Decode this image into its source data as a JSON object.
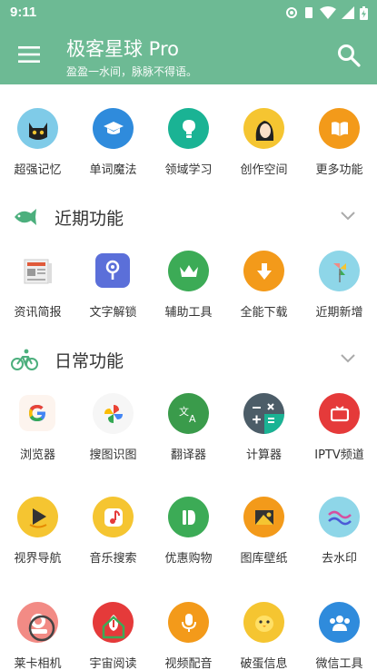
{
  "status": {
    "time": "9:11"
  },
  "app": {
    "title": "极客星球 Pro",
    "subtitle": "盈盈一水间，脉脉不得语。"
  },
  "top_row": [
    {
      "label": "超强记忆",
      "icon": "cat-icon",
      "color": "#7fcbe8"
    },
    {
      "label": "单词魔法",
      "icon": "graduation-cap-icon",
      "color": "#2f8bdc"
    },
    {
      "label": "领域学习",
      "icon": "lightbulb-icon",
      "color": "#1ab394"
    },
    {
      "label": "创作空间",
      "icon": "girl-portrait-icon",
      "color": "#f5c531"
    },
    {
      "label": "更多功能",
      "icon": "book-icon",
      "color": "#f39a1a"
    }
  ],
  "sections": [
    {
      "title": "近期功能",
      "icon": "fish-icon",
      "items": [
        {
          "label": "资讯简报",
          "icon": "newspaper-icon",
          "color": "#ffffff"
        },
        {
          "label": "文字解锁",
          "icon": "keyhole-icon",
          "color": "#5b6fd9"
        },
        {
          "label": "辅助工具",
          "icon": "crown-icon",
          "color": "#3cab56"
        },
        {
          "label": "全能下载",
          "icon": "download-icon",
          "color": "#f39a1a"
        },
        {
          "label": "近期新增",
          "icon": "pinwheel-icon",
          "color": "#8ed6e8"
        }
      ]
    },
    {
      "title": "日常功能",
      "icon": "bicycle-icon",
      "items": [
        {
          "label": "浏览器",
          "icon": "google-icon",
          "color": "#fdf4ee"
        },
        {
          "label": "搜图识图",
          "icon": "photos-pinwheel-icon",
          "color": "#f6f6f6"
        },
        {
          "label": "翻译器",
          "icon": "translate-icon",
          "color": "#3a9b4b"
        },
        {
          "label": "计算器",
          "icon": "calculator-icon",
          "color": "#4c5d68"
        },
        {
          "label": "IPTV频道",
          "icon": "tv-icon",
          "color": "#e53a3a"
        }
      ]
    }
  ],
  "row_three": [
    {
      "label": "视界导航",
      "icon": "play-icon",
      "color": "#f5c531"
    },
    {
      "label": "音乐搜索",
      "icon": "music-note-icon",
      "color": "#f5c531"
    },
    {
      "label": "优惠购物",
      "icon": "tag-icon",
      "color": "#3cab56"
    },
    {
      "label": "图库壁纸",
      "icon": "image-icon",
      "color": "#f39a1a"
    },
    {
      "label": "去水印",
      "icon": "wave-icon",
      "color": "#8ed6e8"
    }
  ],
  "row_four": [
    {
      "label": "莱卡相机",
      "icon": "camera-icon",
      "color": "#f28b85"
    },
    {
      "label": "宇宙阅读",
      "icon": "reading-icon",
      "color": "#e53a3a"
    },
    {
      "label": "视频配音",
      "icon": "microphone-icon",
      "color": "#f39a1a"
    },
    {
      "label": "破蛋信息",
      "icon": "chick-icon",
      "color": "#f5c531"
    },
    {
      "label": "微信工具",
      "icon": "people-icon",
      "color": "#2f8bdc"
    }
  ],
  "colors": {
    "header": "#6dba94",
    "accent": "#4caf7d"
  }
}
